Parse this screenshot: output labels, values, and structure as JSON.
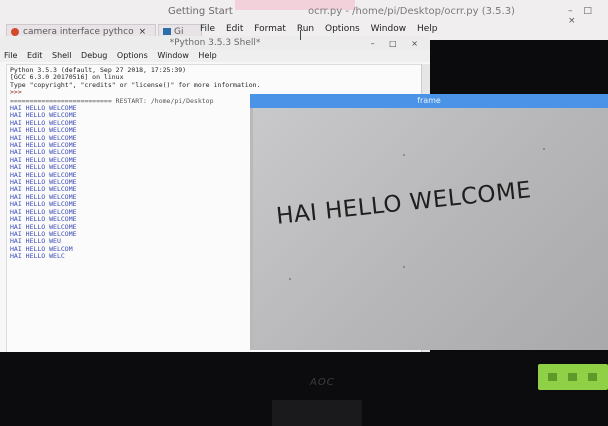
{
  "browser": {
    "getting_started": "Getting Start",
    "tab_label": "camera interface pythco",
    "tab_close": "×",
    "tab2_label": "Gi",
    "window_controls": "– □ ×"
  },
  "editor": {
    "title": "ocrr.py - /home/pi/Desktop/ocrr.py (3.5.3)",
    "menu": [
      "File",
      "Edit",
      "Format",
      "Run",
      "Options",
      "Window",
      "Help"
    ]
  },
  "shell": {
    "title": "*Python 3.5.3 Shell*",
    "controls": "– □ ×",
    "menu": [
      "File",
      "Edit",
      "Shell",
      "Debug",
      "Options",
      "Window",
      "Help"
    ],
    "header_lines": [
      "Python 3.5.3 (default, Sep 27 2018, 17:25:39)",
      "[GCC 6.3.0 20170516] on linux",
      "Type \"copyright\", \"credits\" or \"license()\" for more information."
    ],
    "prompt": ">>>",
    "restart_line": "========================== RESTART: /home/pi/Desktop",
    "output_lines": [
      "HAI HELLO WELCOME",
      "HAI HELLO WELCOME",
      "HAI HELLO WELCOME",
      "HAI HELLO WELCOME",
      "HAI HELLO WELCOME",
      "HAI HELLO WELCOME",
      "HAI HELLO WELCOME",
      "HAI HELLO WELCOME",
      "HAI HELLO WELCOME",
      "HAI HELLO WELCOME",
      "HAI HELLO WELCOME",
      "HAI HELLO WELCOME",
      "HAI HELLO WELCOME",
      "HAI HELLO WELCOME",
      "HAI HELLO WELCOME",
      "HAI HELLO WELCOME",
      "HAI HELLO WELCOME",
      "HAI HELLO WELCOME",
      "HAI HELLO WEU",
      "HAI HELLO WELCOM",
      "HAI HELLO WELC"
    ]
  },
  "frame": {
    "title": "frame",
    "ocr_text": "HAI HELLO WELCOME"
  },
  "monitor": {
    "brand": "AOC"
  },
  "colors": {
    "frame_titlebar": "#4a93e6",
    "output_text": "#3a4ab8",
    "led_panel": "#8fd047"
  }
}
